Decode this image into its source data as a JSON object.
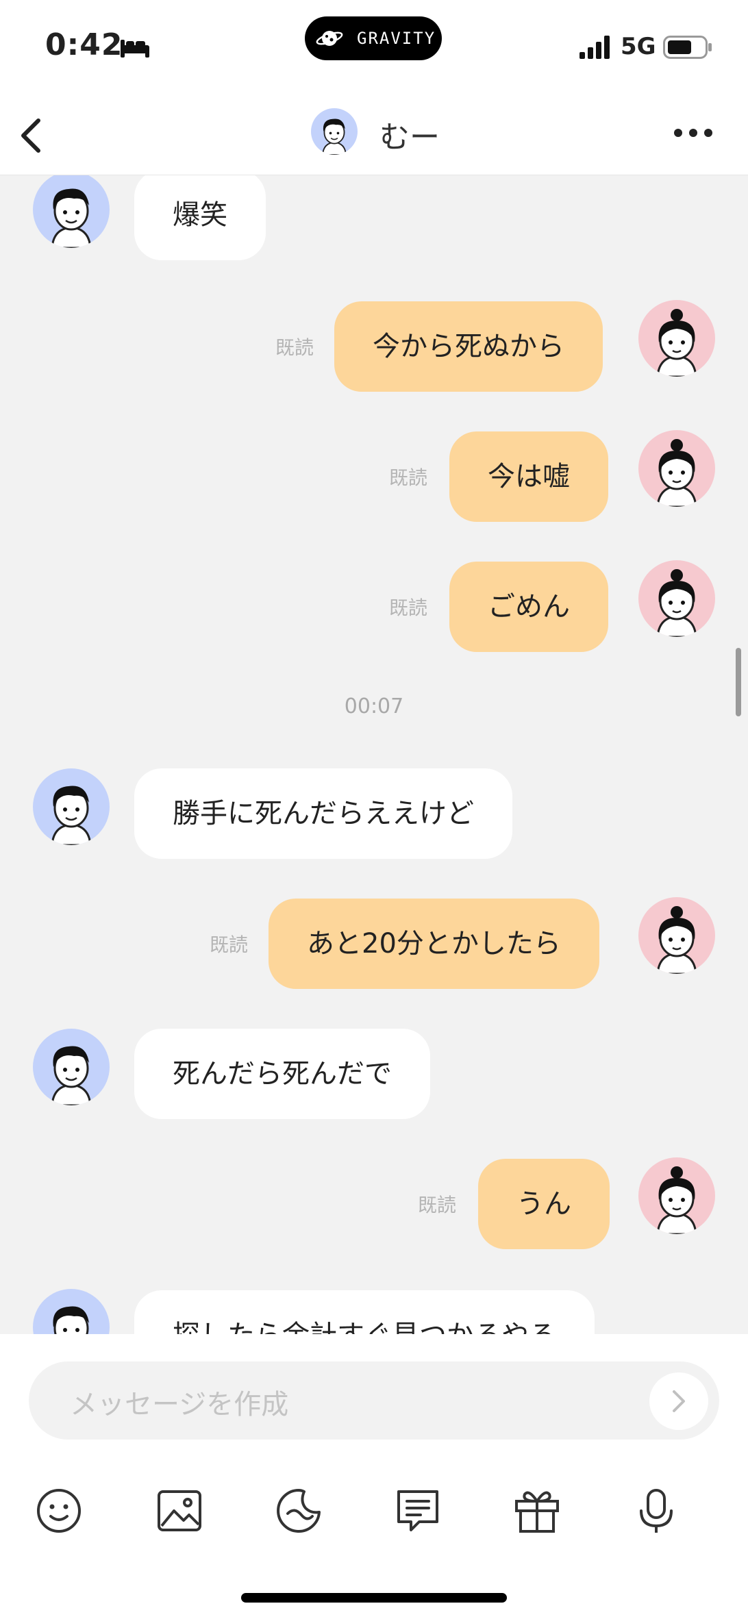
{
  "status_bar": {
    "time": "0:42",
    "dynamic_island_label": "GRAVITY",
    "network": "5G"
  },
  "header": {
    "title": "むー"
  },
  "messages": [
    {
      "side": "in",
      "text": "爆笑"
    },
    {
      "side": "out",
      "text": "今から死ぬから",
      "read": "既読"
    },
    {
      "side": "out",
      "text": "今は嘘",
      "read": "既読"
    },
    {
      "side": "out",
      "text": "ごめん",
      "read": "既読"
    },
    {
      "side": "time",
      "text": "00:07"
    },
    {
      "side": "in",
      "text": "勝手に死んだらええけど"
    },
    {
      "side": "out",
      "text": "あと20分とかしたら",
      "read": "既読"
    },
    {
      "side": "in",
      "text": "死んだら死んだで"
    },
    {
      "side": "out",
      "text": "うん",
      "read": "既読"
    },
    {
      "side": "in",
      "text": "探したら余計すぐ見つかるやろ"
    }
  ],
  "composer": {
    "placeholder": "メッセージを作成"
  },
  "toolbar": {
    "icons": [
      "emoji-icon",
      "image-icon",
      "sticker-icon",
      "text-message-icon",
      "gift-icon",
      "microphone-icon"
    ]
  },
  "colors": {
    "incoming_bubble": "#ffffff",
    "outgoing_bubble": "#fdd69a",
    "boy_avatar_bg": "#c3d2fb",
    "girl_avatar_bg": "#f6c9cf",
    "chat_bg": "#f2f2f2"
  }
}
